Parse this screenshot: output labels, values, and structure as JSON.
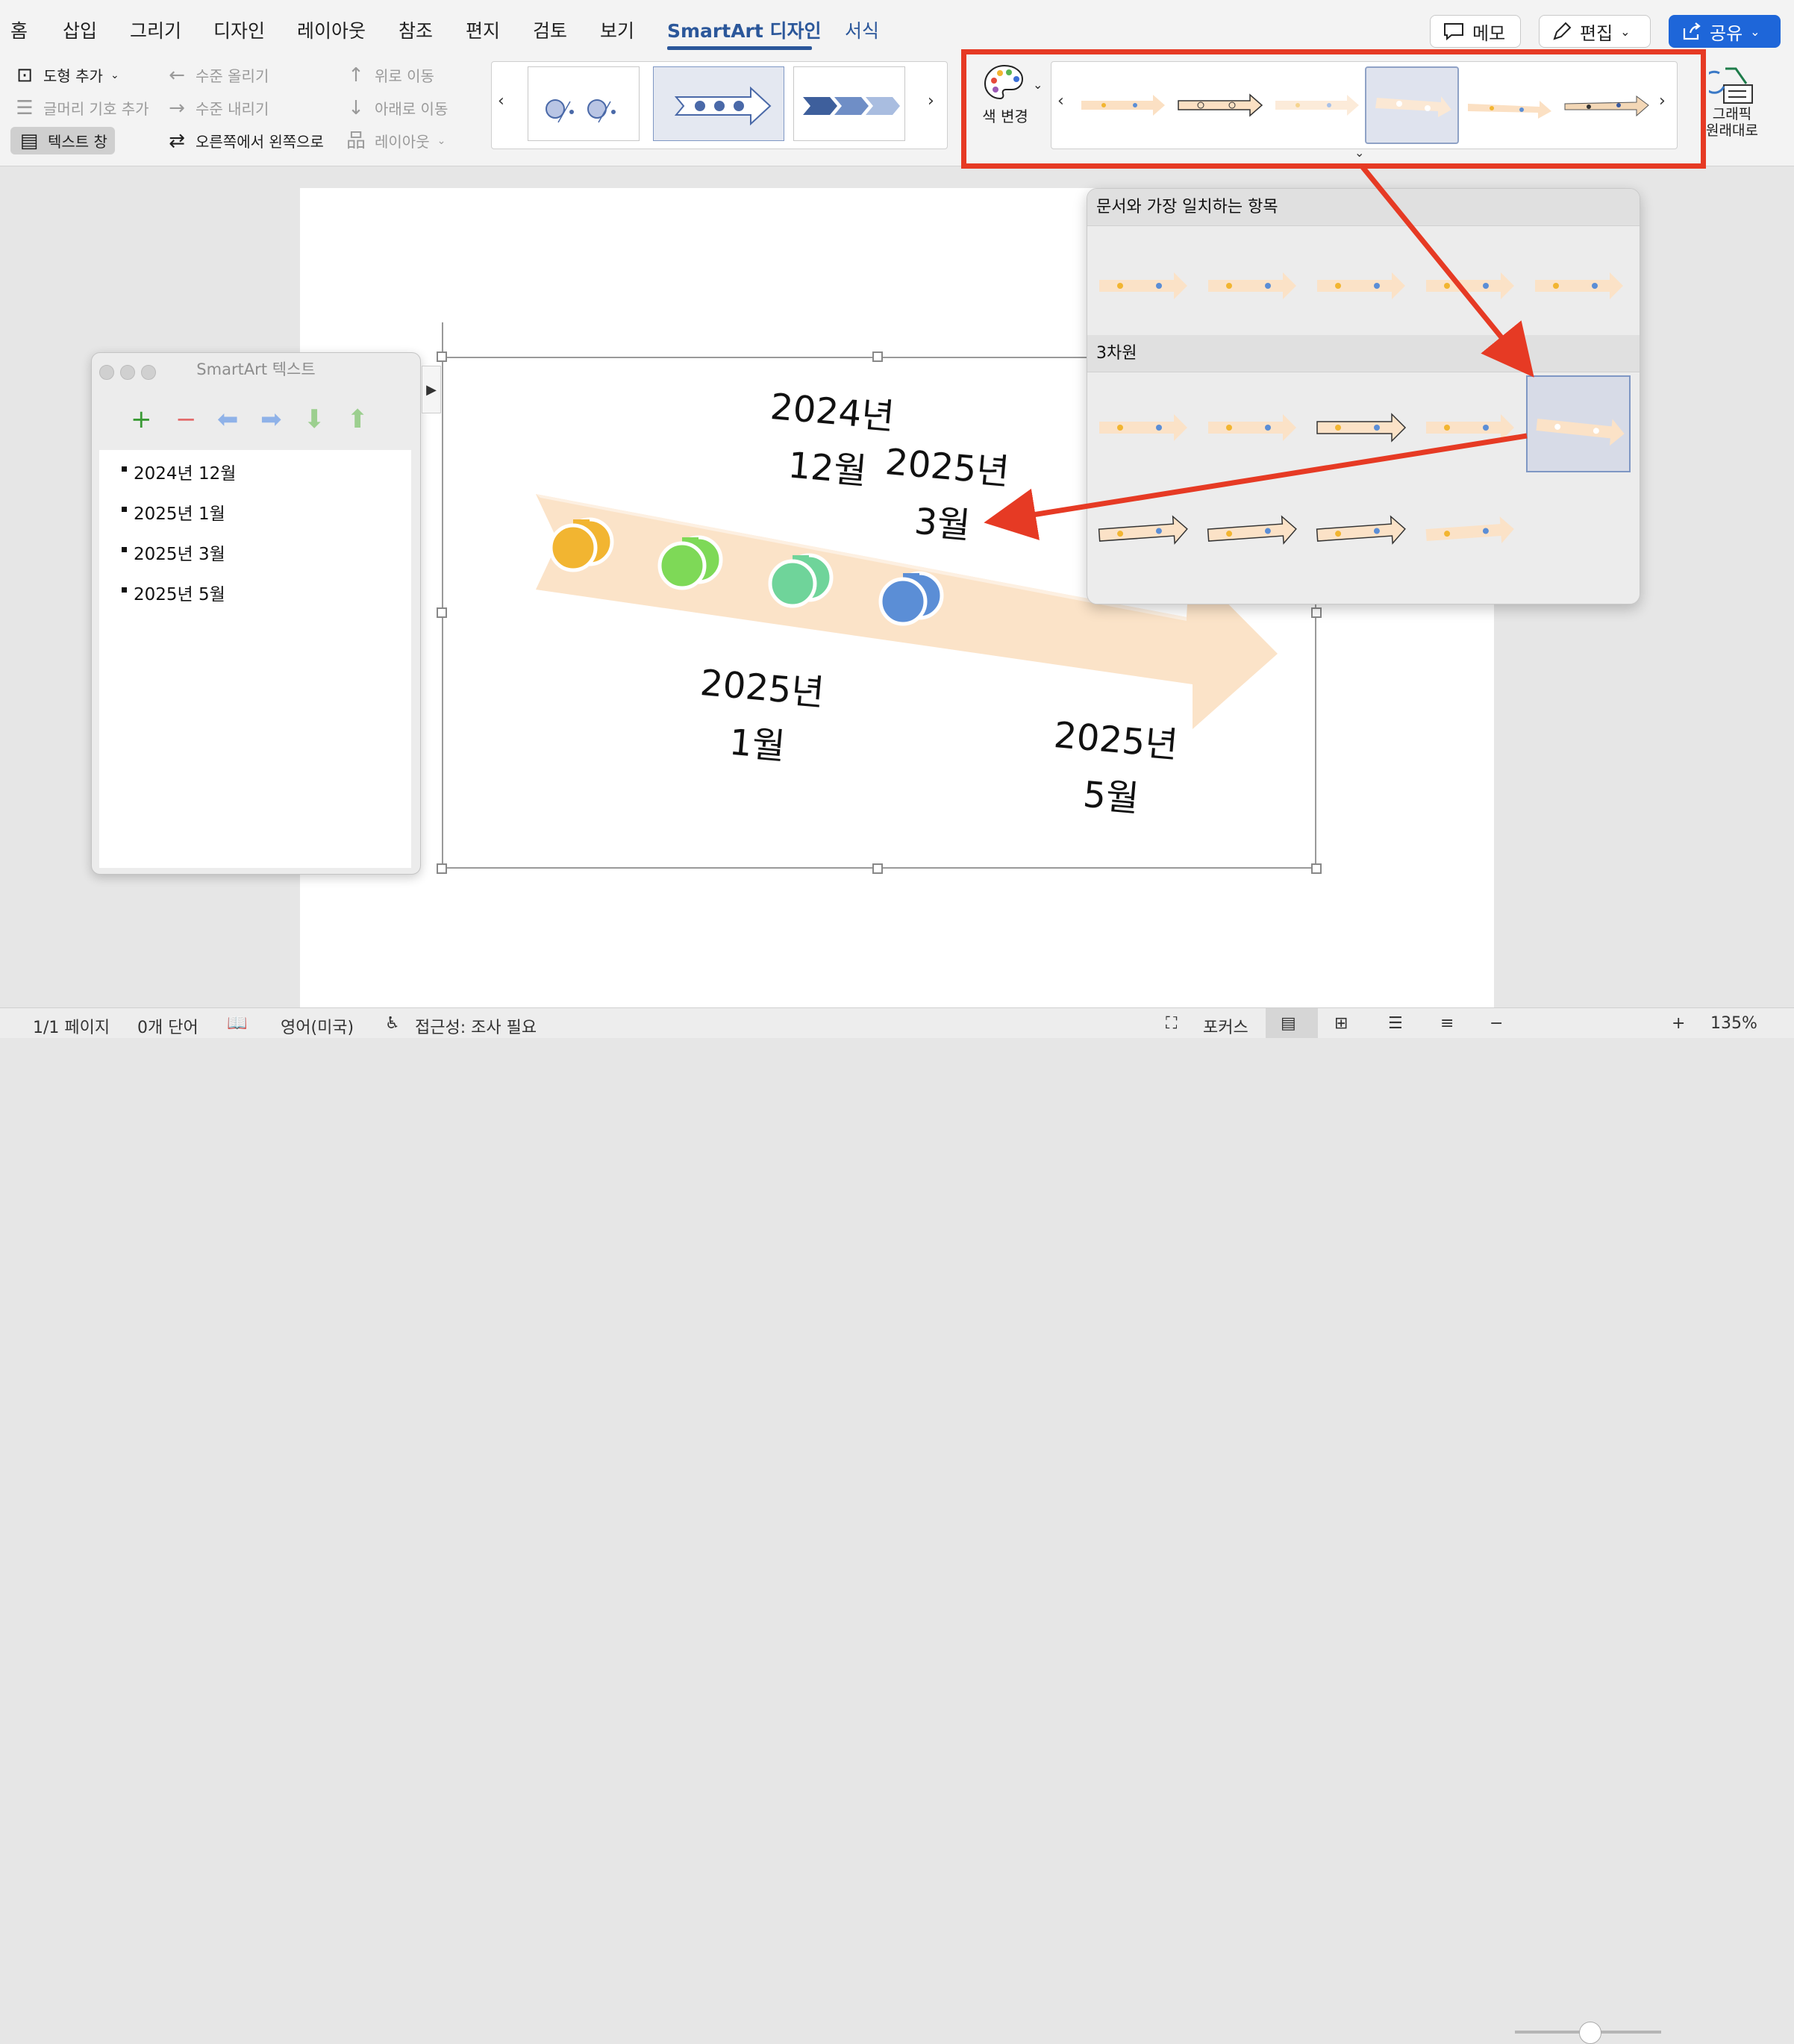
{
  "tabs": [
    "홈",
    "삽입",
    "그리기",
    "디자인",
    "레이아웃",
    "참조",
    "편지",
    "검토",
    "보기",
    "SmartArt 디자인",
    "서식"
  ],
  "active_tab": "SmartArt 디자인",
  "top_buttons": {
    "comment": "메모",
    "edit": "편집",
    "share": "공유"
  },
  "ribbon": {
    "add_shape": "도형 추가",
    "add_bullet": "글머리 기호 추가",
    "text_pane": "텍스트 창",
    "promote": "수준 올리기",
    "demote": "수준 내리기",
    "right_to_left": "오른쪽에서 왼쪽으로",
    "move_up": "위로 이동",
    "move_down": "아래로 이동",
    "layout": "레이아웃",
    "change_colors": "색 변경",
    "reset_graphic": "그래픽\n원래대로"
  },
  "text_pane": {
    "title": "SmartArt 텍스트",
    "items": [
      "2024년 12월",
      "2025년 1월",
      "2025년 3월",
      "2025년 5월"
    ]
  },
  "smartart": {
    "labels": [
      {
        "year": "2024년",
        "month": "12월"
      },
      {
        "year": "2025년",
        "month": "1월"
      },
      {
        "year": "2025년",
        "month": "3월"
      },
      {
        "year": "2025년",
        "month": "5월"
      }
    ],
    "dot_colors": [
      "#f2b531",
      "#7ed957",
      "#6fd49a",
      "#5b8ed6"
    ],
    "arrow_color": "#fae3c8"
  },
  "dropdown": {
    "section_best": "문서와 가장 일치하는 항목",
    "section_3d": "3차원"
  },
  "status": {
    "page": "1/1 페이지",
    "words": "0개 단어",
    "language": "영어(미국)",
    "accessibility": "접근성: 조사 필요",
    "focus": "포커스",
    "zoom": "135%"
  },
  "colors": {
    "accent": "#2b579a",
    "highlight_red": "#e63a24"
  }
}
